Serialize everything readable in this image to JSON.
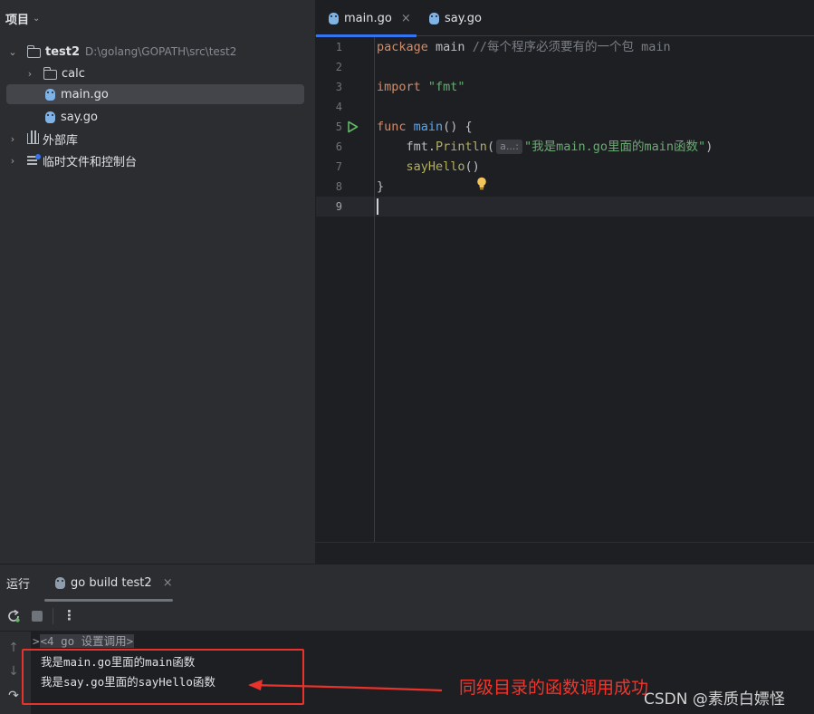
{
  "project_panel": {
    "title": "项目",
    "tree": [
      {
        "label": "test2",
        "path_hint": "D:\\golang\\GOPATH\\src\\test2"
      },
      {
        "label": "calc"
      },
      {
        "label": "main.go"
      },
      {
        "label": "say.go"
      },
      {
        "label": "外部库"
      },
      {
        "label": "临时文件和控制台"
      }
    ]
  },
  "editor": {
    "tabs": [
      {
        "label": "main.go",
        "active": true,
        "close": "×"
      },
      {
        "label": "say.go",
        "active": false
      }
    ],
    "line_numbers": [
      "1",
      "2",
      "3",
      "4",
      "5",
      "6",
      "7",
      "8",
      "9"
    ],
    "code": {
      "l1_kw": "package",
      "l1_name": " main ",
      "l1_comment": "//每个程序必须要有的一个包 main",
      "l3_kw": "import",
      "l3_str": " \"fmt\"",
      "l5_kw": "func",
      "l5_fn": " main",
      "l5_rest": "() {",
      "l6_pkg": "    fmt.",
      "l6_call": "Println",
      "l6_open": "(",
      "l6_hint": "a...:",
      "l6_str": "\"我是main.go里面的main函数\"",
      "l6_close": ")",
      "l7_call": "    sayHello",
      "l7_rest": "()",
      "l8": "}"
    }
  },
  "run_panel": {
    "title": "运行",
    "tab_label": "go build test2",
    "tab_close": "×",
    "folded_marker": ">",
    "folded_text": "<4 go 设置调用>",
    "output": [
      "我是main.go里面的main函数",
      "我是say.go里面的sayHello函数"
    ]
  },
  "annotation": {
    "text": "同级目录的函数调用成功",
    "color": "#e8322b"
  },
  "watermark": "CSDN @素质白嫖怪",
  "colors": {
    "accent": "#3574f0",
    "keyword": "#cf8e6d",
    "function": "#56a8f5",
    "string": "#6aab73",
    "comment": "#7a7e85"
  }
}
